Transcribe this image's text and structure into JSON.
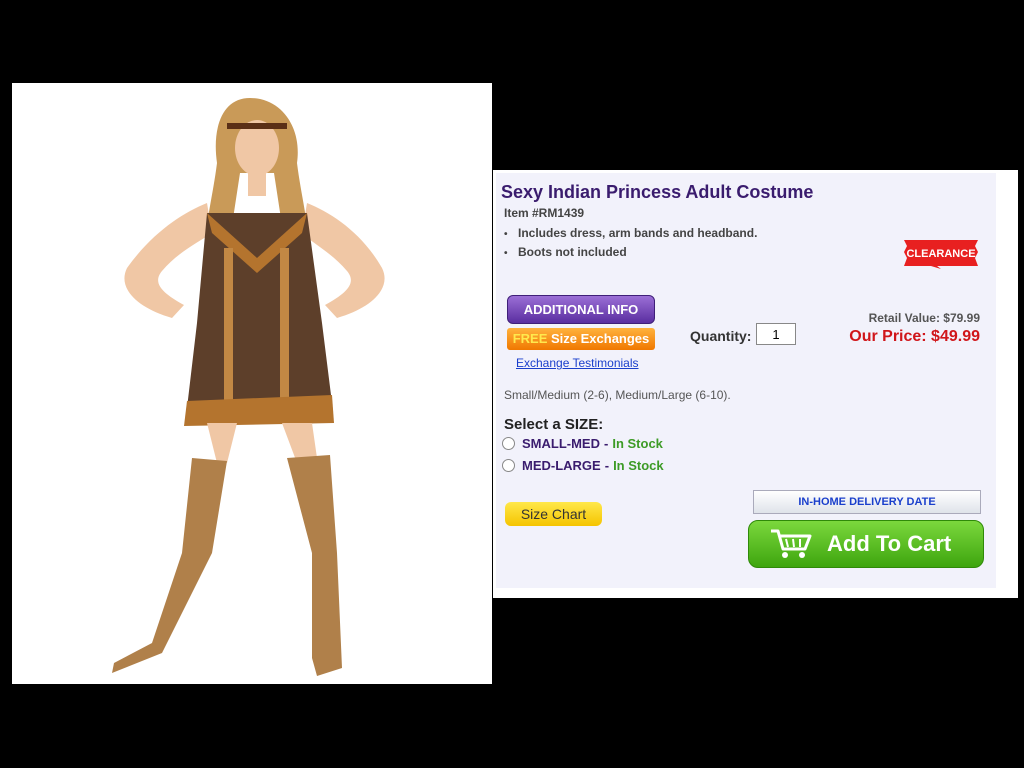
{
  "product": {
    "title": "Sexy Indian Princess Adult Costume",
    "item_number": "Item #RM1439",
    "bullets": [
      "Includes dress, arm bands and headband.",
      "Boots not included"
    ],
    "clearance_badge": "CLEARANCE",
    "additional_info_label": "ADDITIONAL INFO",
    "free_label": "FREE",
    "size_exchanges_label": "Size Exchanges",
    "testimonials_link": "Exchange Testimonials",
    "quantity_label": "Quantity:",
    "quantity_value": "1",
    "retail_value": "Retail Value: $79.99",
    "our_price": "Our Price: $49.99",
    "size_range_text": "Small/Medium (2-6), Medium/Large (6-10).",
    "select_size_label": "Select a SIZE:",
    "size_options": [
      {
        "label": "SMALL-MED",
        "stock": "In Stock"
      },
      {
        "label": "MED-LARGE",
        "stock": "In Stock"
      }
    ],
    "size_chart_label": "Size Chart",
    "delivery_date_label": "IN-HOME DELIVERY DATE",
    "add_to_cart_label": "Add To Cart"
  },
  "colors": {
    "title": "#3a1c6e",
    "price": "#d0161a",
    "in_stock": "#3d9b26",
    "cart_button": "#4cb51a",
    "clearance": "#e82020"
  },
  "icons": [
    "cart-icon",
    "clearance-badge"
  ]
}
